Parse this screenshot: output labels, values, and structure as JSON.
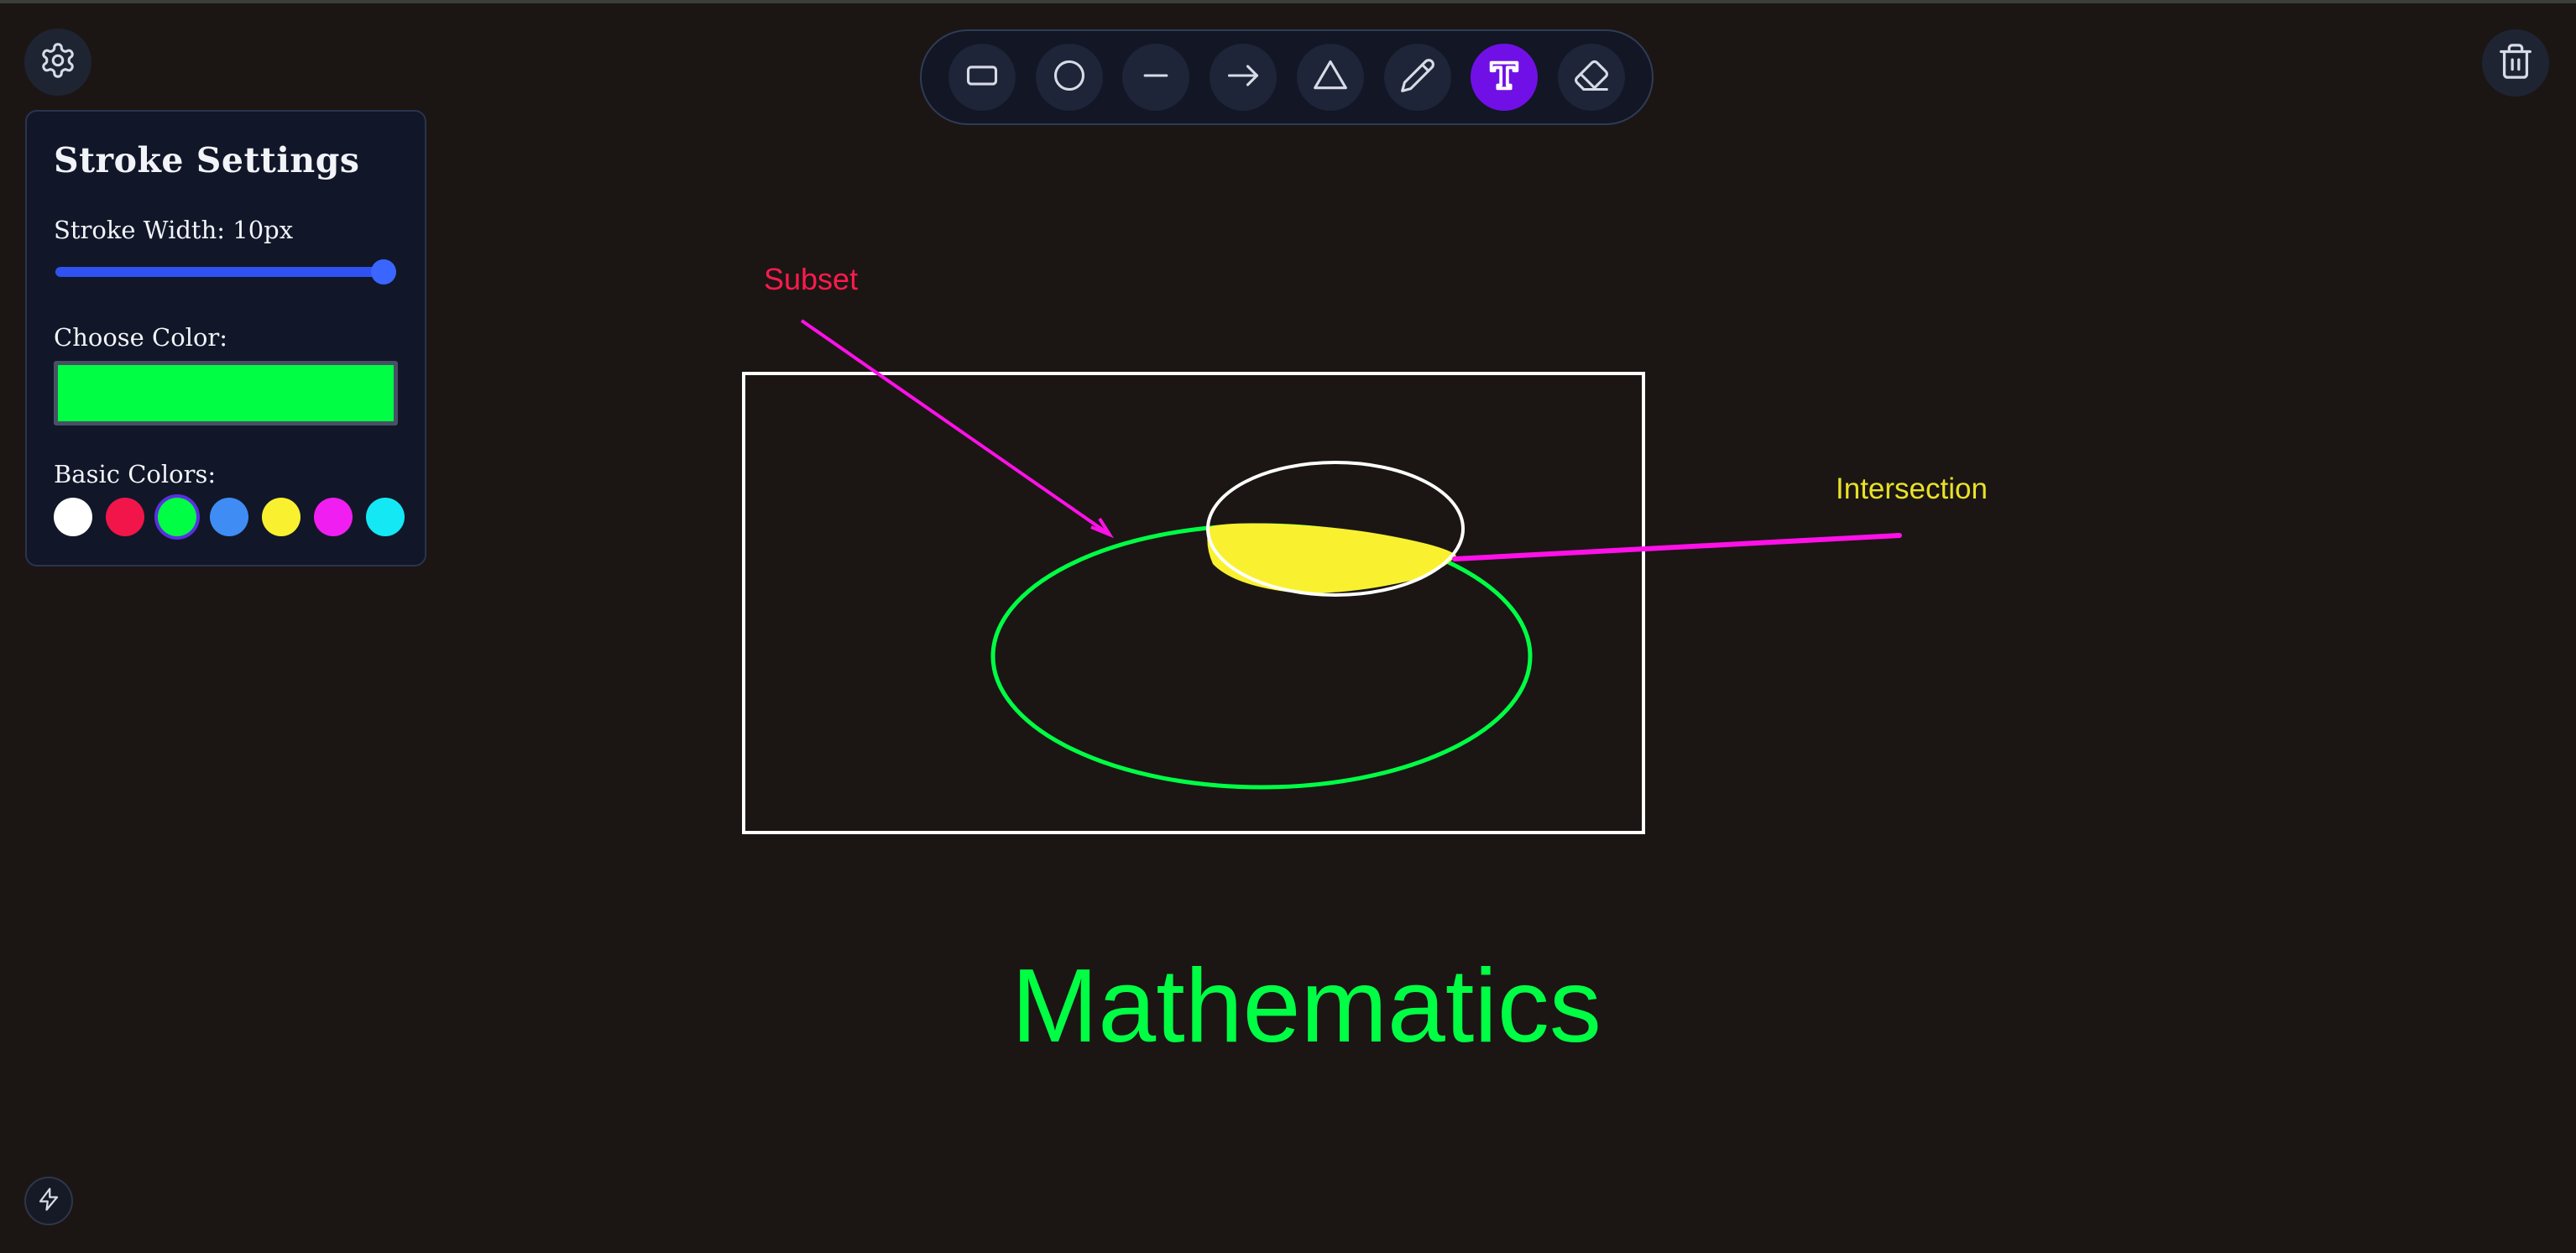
{
  "settings_button": {
    "icon": "gear-icon"
  },
  "trash_button": {
    "icon": "trash-icon"
  },
  "bottom_button": {
    "icon": "lightning-icon"
  },
  "toolbar": {
    "tools": [
      {
        "name": "rectangle",
        "icon": "rectangle-icon",
        "active": false
      },
      {
        "name": "circle",
        "icon": "circle-icon",
        "active": false
      },
      {
        "name": "line",
        "icon": "line-icon",
        "active": false
      },
      {
        "name": "arrow",
        "icon": "arrow-icon",
        "active": false
      },
      {
        "name": "triangle",
        "icon": "triangle-icon",
        "active": false
      },
      {
        "name": "pencil",
        "icon": "pencil-icon",
        "active": false
      },
      {
        "name": "text",
        "icon": "text-icon",
        "active": true
      },
      {
        "name": "eraser",
        "icon": "eraser-icon",
        "active": false
      }
    ],
    "active_color": "#7010e6"
  },
  "stroke_panel": {
    "title": "Stroke Settings",
    "stroke_width_label": "Stroke Width: 10px",
    "stroke_width_fraction": 1.0,
    "choose_color_label": "Choose Color:",
    "selected_color": "#00ff44",
    "basic_colors_label": "Basic Colors:",
    "basic_colors": [
      "#ffffff",
      "#f2154a",
      "#00ff44",
      "#3f8cf5",
      "#f9f12f",
      "#f01ef0",
      "#14e8f5"
    ],
    "selected_basic_color_index": 2
  },
  "canvas": {
    "texts": {
      "subset": {
        "text": "Subset",
        "color": "#ff1a4d"
      },
      "intersection": {
        "text": "Intersection",
        "color": "#e8e128"
      },
      "mathematics": {
        "text": "Mathematics",
        "color": "#00ff44"
      }
    },
    "colors": {
      "rectangle": "#ffffff",
      "green_ellipse": "#00ff44",
      "white_ellipse": "#ffffff",
      "intersection_fill": "#f9f12f",
      "arrows": "#ff10e8"
    }
  }
}
